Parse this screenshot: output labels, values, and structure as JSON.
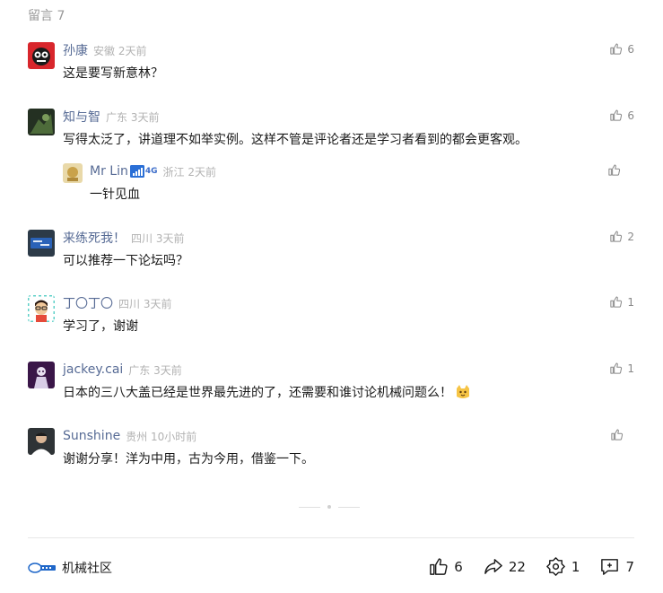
{
  "header": {
    "title": "留言 7"
  },
  "comments": [
    {
      "name": "孙康",
      "location": "安徽 2天前",
      "text": "这是要写新意林？",
      "likes": "6"
    },
    {
      "name": "知与智",
      "location": "广东 3天前",
      "text": "写得太泛了，讲道理不如举实例。这样不管是评论者还是学习者看到的都会更客观。",
      "likes": "6",
      "reply": {
        "name": "Mr Lin",
        "signal_label": "4G",
        "location": "浙江 2天前",
        "text": "一针见血",
        "likes": ""
      }
    },
    {
      "name": "来练死我！",
      "location": "四川 3天前",
      "text": "可以推荐一下论坛吗？",
      "likes": "2"
    },
    {
      "name": "丁〇丁〇",
      "location": "四川 3天前",
      "text": "学习了，谢谢",
      "likes": "1"
    },
    {
      "name": "jackey.cai",
      "location": "广东 3天前",
      "text": "日本的三八大盖已经是世界最先进的了，还需要和谁讨论机械问题么！",
      "emoji": "cat-emoji",
      "likes": "1"
    },
    {
      "name": "Sunshine",
      "location": "贵州 10小时前",
      "text": "谢谢分享！洋为中用，古为今用，借鉴一下。",
      "likes": ""
    }
  ],
  "footer": {
    "brand_name": "机械社区",
    "like_count": "6",
    "share_count": "22",
    "wow_count": "1",
    "comment_count": "7"
  },
  "colors": {
    "name": "#576b95",
    "meta": "#b2b2b2",
    "text": "#1a1a1a"
  },
  "icons": [
    "thumb-up-icon",
    "share-icon",
    "wow-icon",
    "comment-add-icon",
    "signal-icon"
  ]
}
